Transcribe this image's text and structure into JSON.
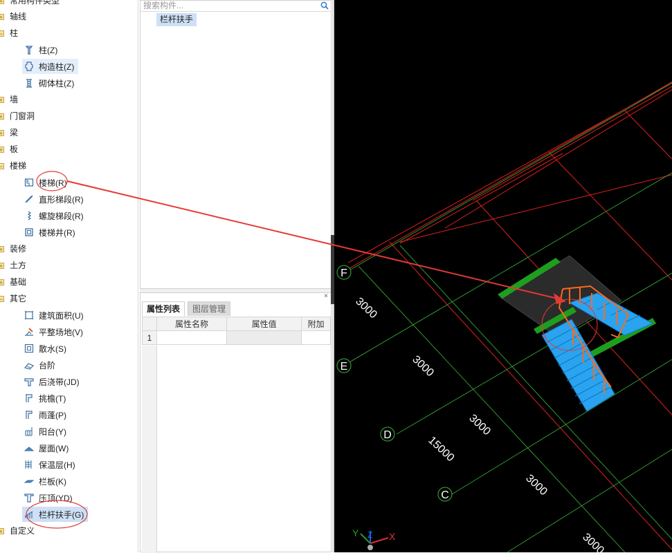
{
  "tree": {
    "top_partial": "常用构件类型",
    "categories": [
      {
        "label": "轴线",
        "expanded": false
      },
      {
        "label": "柱",
        "expanded": true,
        "children": [
          "柱(Z)",
          "构造柱(Z)",
          "砌体柱(Z)"
        ]
      },
      {
        "label": "墙",
        "expanded": false
      },
      {
        "label": "门窗洞",
        "expanded": false
      },
      {
        "label": "梁",
        "expanded": false
      },
      {
        "label": "板",
        "expanded": false
      },
      {
        "label": "楼梯",
        "expanded": true,
        "children": [
          "楼梯(R)",
          "直形梯段(R)",
          "螺旋梯段(R)",
          "楼梯井(R)"
        ]
      },
      {
        "label": "装修",
        "expanded": false
      },
      {
        "label": "土方",
        "expanded": false
      },
      {
        "label": "基础",
        "expanded": false
      },
      {
        "label": "其它",
        "expanded": true,
        "children": [
          "建筑面积(U)",
          "平整场地(V)",
          "散水(S)",
          "台阶",
          "后浇带(JD)",
          "挑檐(T)",
          "雨蓬(P)",
          "阳台(Y)",
          "屋面(W)",
          "保温层(H)",
          "栏板(K)",
          "压顶(YD)",
          "栏杆扶手(G)"
        ]
      },
      {
        "label": "自定义",
        "expanded": false
      }
    ]
  },
  "components": {
    "search_placeholder": "搜索构件...",
    "items": [
      "栏杆扶手"
    ]
  },
  "properties": {
    "tabs": [
      "属性列表",
      "图层管理"
    ],
    "columns": [
      "属性名称",
      "属性值",
      "附加"
    ],
    "rows": [
      "1"
    ],
    "close_symbol": "×"
  },
  "viewport": {
    "axis_labels": [
      "F",
      "E",
      "D",
      "C"
    ],
    "dimensions": [
      "3000",
      "3000",
      "3000",
      "15000",
      "3000",
      "3000"
    ],
    "triad": {
      "x": "X",
      "y": "Y",
      "z": "Z"
    }
  },
  "colors": {
    "grid_red": "#e02020",
    "grid_green": "#2e9a2e",
    "stair_blue": "#2aa3f0",
    "slab_green": "#1e9e1e",
    "rail_orange": "#ff6a1a",
    "annotation_red": "#e53935",
    "selection_bg": "#cde0f5"
  }
}
